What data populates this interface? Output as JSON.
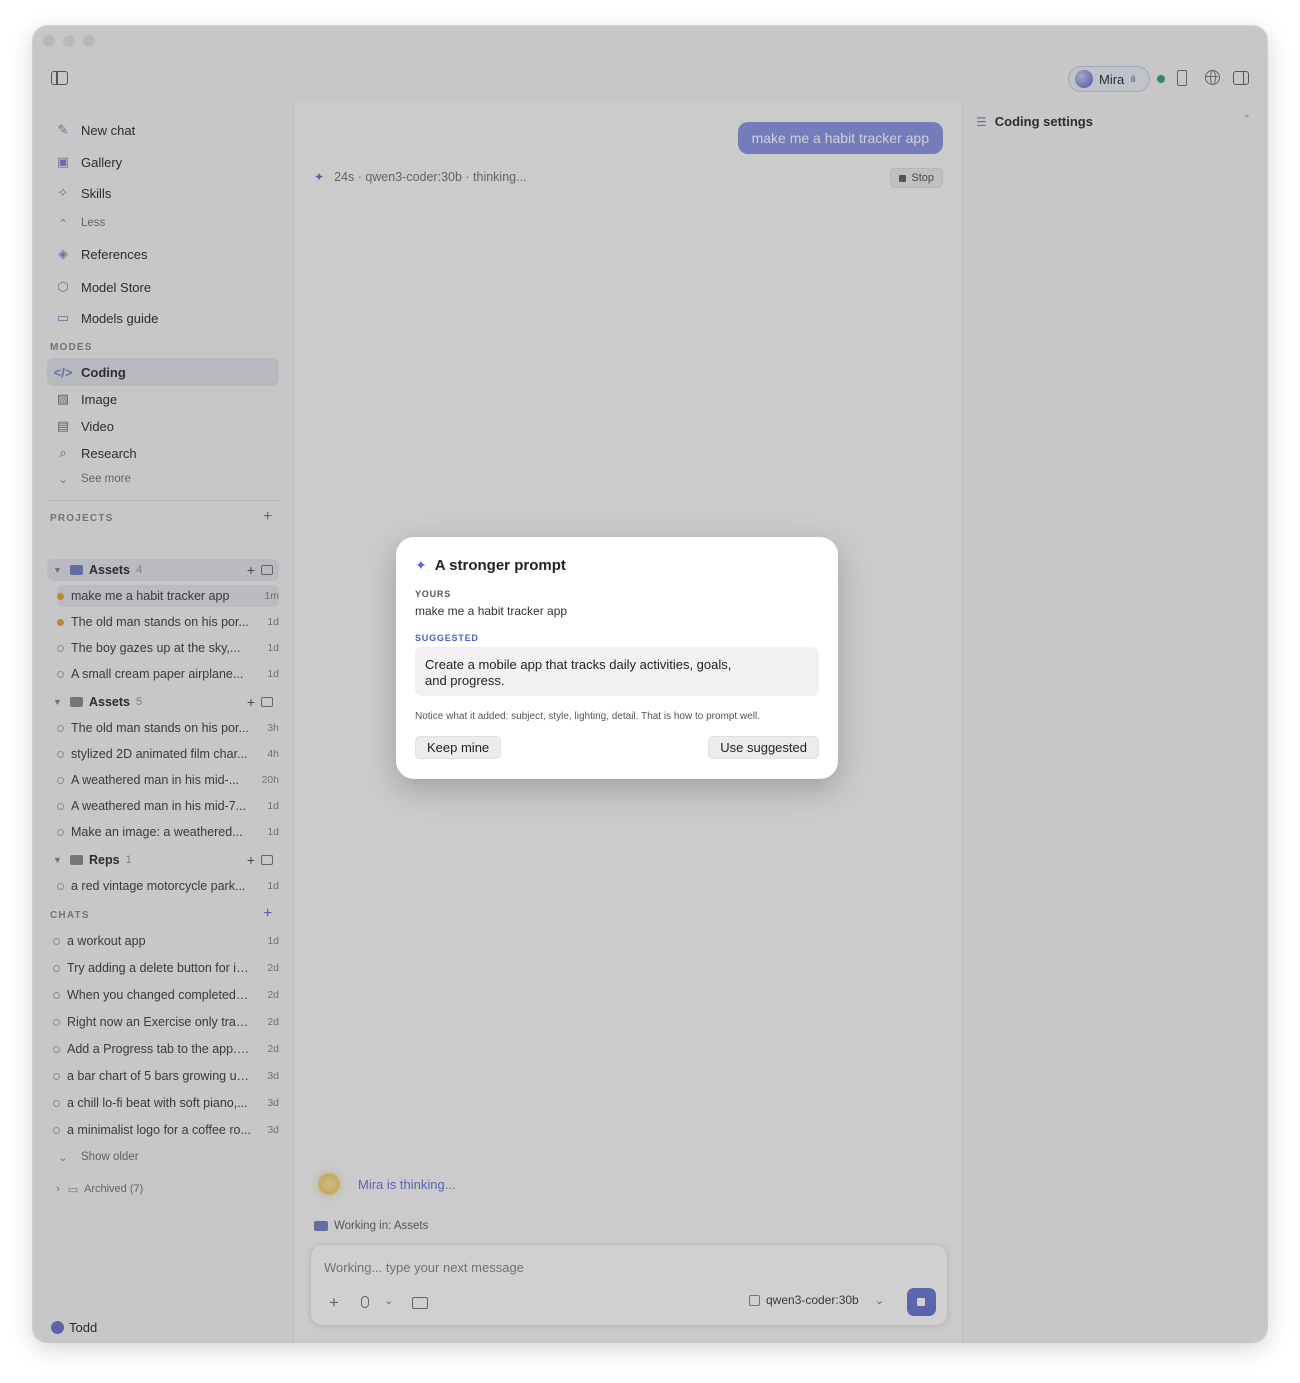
{
  "topbar": {
    "assistant_name": "Mira"
  },
  "sidebar": {
    "nav": [
      {
        "label": "New chat",
        "icon": "compose-icon"
      },
      {
        "label": "Gallery",
        "icon": "gallery-icon"
      },
      {
        "label": "Skills",
        "icon": "skills-icon"
      },
      {
        "label": "Less",
        "icon": "chevron-up-icon"
      },
      {
        "label": "References",
        "icon": "layers-icon"
      },
      {
        "label": "Model Store",
        "icon": "box-icon"
      },
      {
        "label": "Models guide",
        "icon": "book-icon"
      }
    ],
    "modes_heading": "MODES",
    "modes": [
      {
        "label": "Coding",
        "icon": "code-icon",
        "active": true
      },
      {
        "label": "Image",
        "icon": "image-icon"
      },
      {
        "label": "Video",
        "icon": "film-icon"
      },
      {
        "label": "Research",
        "icon": "search-icon"
      },
      {
        "label": "See more",
        "icon": "chevron-down-icon"
      }
    ],
    "projects_heading": "PROJECTS",
    "projects": [
      {
        "name": "Assets",
        "count": "4",
        "items": [
          {
            "title": "make me a habit tracker app",
            "time": "1m"
          },
          {
            "title": "The old man stands on his por...",
            "time": "1d"
          },
          {
            "title": "The boy gazes up at the sky,...",
            "time": "1d"
          },
          {
            "title": "A small cream paper airplane...",
            "time": "1d"
          }
        ]
      },
      {
        "name": "Assets",
        "count": "5",
        "items": [
          {
            "title": "The old man stands on his por...",
            "time": "3h"
          },
          {
            "title": "stylized 2D animated film char...",
            "time": "4h"
          },
          {
            "title": "A weathered man in his mid-...",
            "time": "20h"
          },
          {
            "title": "A weathered man in his mid-7...",
            "time": "1d"
          },
          {
            "title": "Make an image: a weathered...",
            "time": "1d"
          }
        ]
      },
      {
        "name": "Reps",
        "count": "1",
        "items": [
          {
            "title": "a red vintage motorcycle park...",
            "time": "1d"
          }
        ]
      }
    ],
    "chats_heading": "CHATS",
    "chats": [
      {
        "title": "a workout app",
        "time": "1d"
      },
      {
        "title": "Try adding a delete button for in...",
        "time": "2d"
      },
      {
        "title": "When you changed completedS...",
        "time": "2d"
      },
      {
        "title": "Right now an Exercise only trac...",
        "time": "2d"
      },
      {
        "title": "Add a Progress tab to the app. I...",
        "time": "2d"
      },
      {
        "title": "a bar chart of 5 bars growing up...",
        "time": "3d"
      },
      {
        "title": "a chill lo-fi beat with soft piano,...",
        "time": "3d"
      },
      {
        "title": "a minimalist logo for a coffee ro...",
        "time": "3d"
      }
    ],
    "show_older": "Show older",
    "archived": "Archived (7)",
    "user": "Todd"
  },
  "main": {
    "user_message": "make me a habit tracker app",
    "status": "24s · qwen3-coder:30b · thinking...",
    "stop_label": "Stop",
    "assistant_thinking": "Mira is thinking...",
    "working_in": "Working in: Assets",
    "composer_placeholder": "Working... type your next message",
    "model": "qwen3-coder:30b"
  },
  "right_panel": {
    "title": "Coding settings"
  },
  "modal": {
    "title": "A stronger prompt",
    "yours_label": "YOURS",
    "yours_text": "make me a habit tracker app",
    "suggested_label": "SUGGESTED",
    "suggested_text": "Create a mobile app that tracks daily activities, goals, and progress.",
    "notice": "Notice what it added: subject, style, lighting, detail. That is how to prompt well.",
    "keep_label": "Keep mine",
    "use_label": "Use suggested"
  },
  "colors": {
    "accent": "#6c79d6",
    "user_bubble": "#8d97e6",
    "status_online": "#3fa56a",
    "recent_dot": "#e9a33b"
  }
}
